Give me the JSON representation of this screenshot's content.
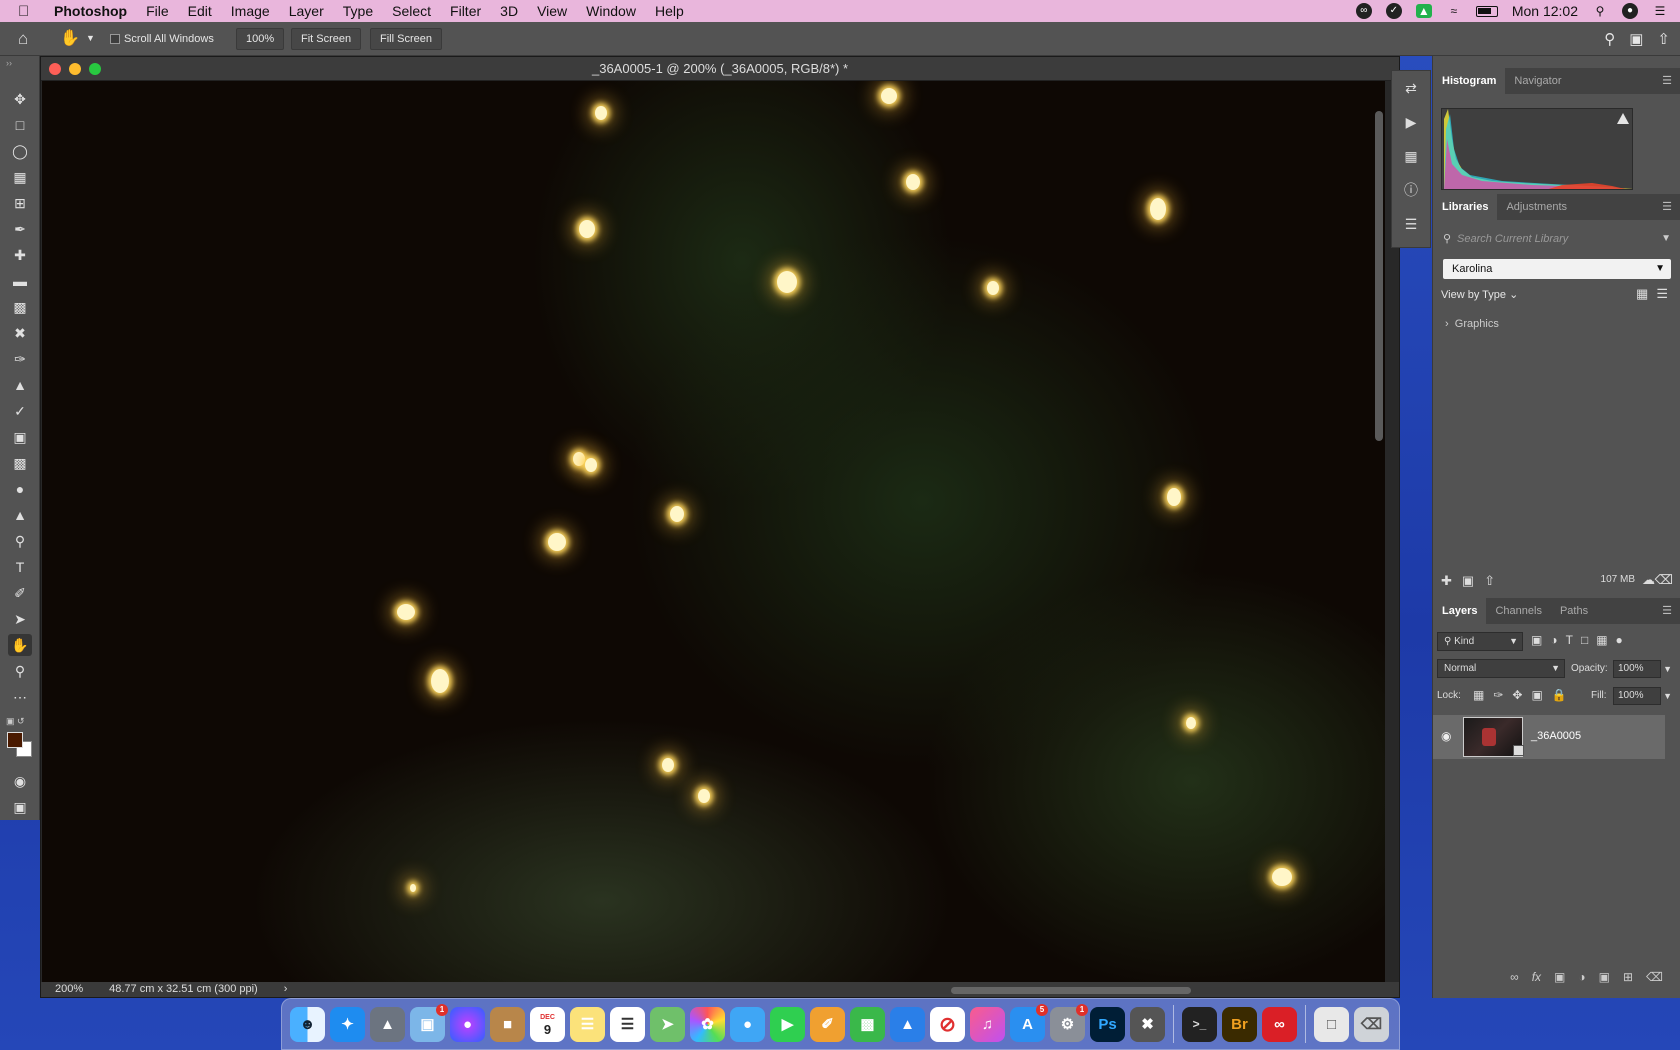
{
  "menubar": {
    "app_name": "Photoshop",
    "menus": [
      "File",
      "Edit",
      "Image",
      "Layer",
      "Type",
      "Select",
      "Filter",
      "3D",
      "View",
      "Window",
      "Help"
    ],
    "clock": "Mon 12:02"
  },
  "options_bar": {
    "scroll_all_windows_label": "Scroll All Windows",
    "zoom_button": "100%",
    "fit_screen_button": "Fit Screen",
    "fill_screen_button": "Fill Screen"
  },
  "document": {
    "title": "_36A0005-1 @ 200% (_36A0005, RGB/8*) *",
    "zoom": "200%",
    "dimensions": "48.77 cm x 32.51 cm (300 ppi)",
    "status_arrow": "›"
  },
  "panels": {
    "histogram_tabs": [
      "Histogram",
      "Navigator"
    ],
    "library_tabs": [
      "Libraries",
      "Adjustments"
    ],
    "library_search_placeholder": "Search Current Library",
    "library_name": "Karolina",
    "view_by": "View by Type",
    "graphics_label": "Graphics",
    "library_size": "107 MB",
    "layer_tabs": [
      "Layers",
      "Channels",
      "Paths"
    ],
    "kind_filter": "Kind",
    "blend_mode": "Normal",
    "opacity_label": "Opacity:",
    "opacity_value": "100%",
    "lock_label": "Lock:",
    "fill_label": "Fill:",
    "fill_value": "100%",
    "layer_name": "_36A0005"
  },
  "dock": {
    "calendar_day": "9",
    "calendar_month": "DEC",
    "photoshop_label": "Ps",
    "bridge_label": "Br"
  },
  "colors": {
    "menubar_bg": "#e9b6dc",
    "foreground_swatch": "#4a1a00",
    "background_swatch": "#ffffff"
  }
}
